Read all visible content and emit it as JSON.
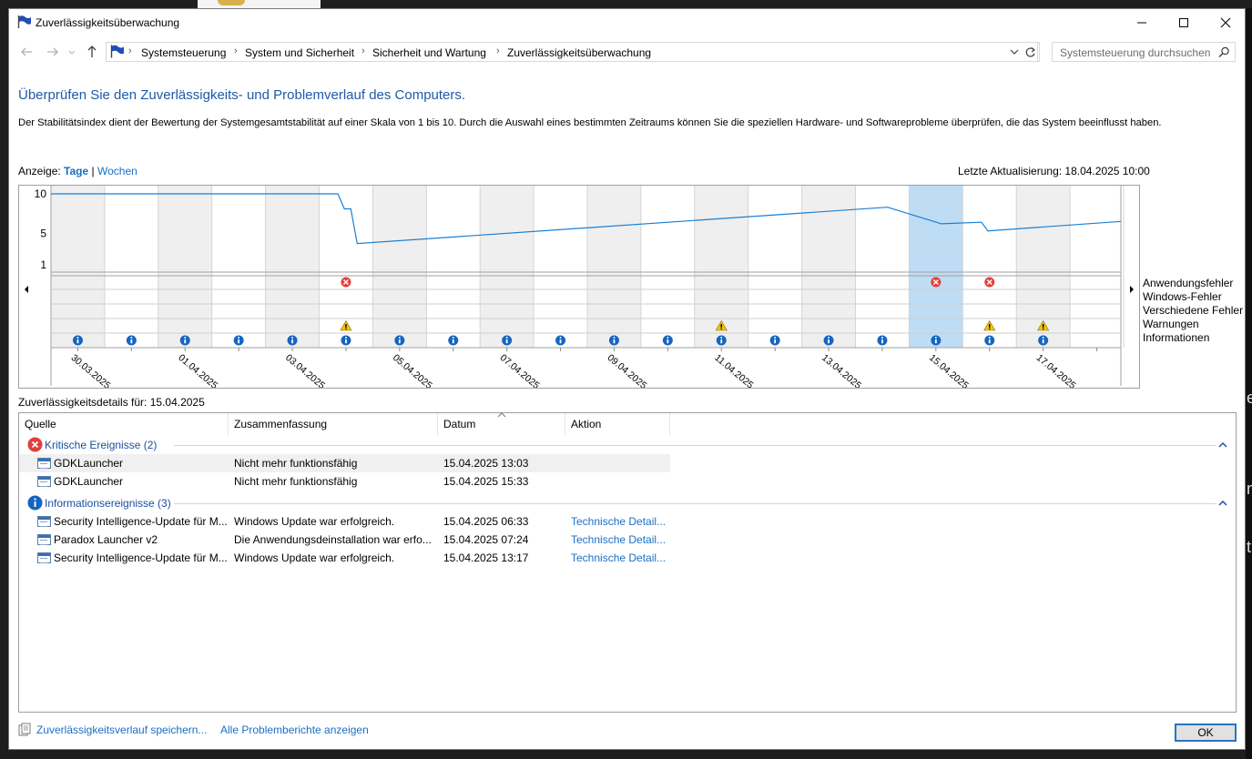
{
  "window": {
    "title": "Zuverlässigkeitsüberwachung"
  },
  "nav": {
    "breadcrumbs": [
      "Systemsteuerung",
      "System und Sicherheit",
      "Sicherheit und Wartung",
      "Zuverlässigkeitsüberwachung"
    ],
    "search_placeholder": "Systemsteuerung durchsuchen"
  },
  "page": {
    "heading": "Überprüfen Sie den Zuverlässigkeits- und Problemverlauf des Computers.",
    "description": "Der Stabilitätsindex dient der Bewertung der Systemgesamtstabilität auf einer Skala von 1 bis 10. Durch die Auswahl eines bestimmten Zeitraums können Sie die speziellen Hardware- und Softwareprobleme überprüfen, die das System beeinflusst haben.",
    "view_label": "Anzeige:",
    "view_days": "Tage",
    "view_separator": "|",
    "view_weeks": "Wochen",
    "last_update": "Letzte Aktualisierung: 18.04.2025 10:00"
  },
  "chart_data": {
    "type": "line",
    "ylim": [
      1,
      10
    ],
    "y_ticks": [
      "10",
      "5",
      "1"
    ],
    "dates": [
      "30.03.2025",
      "31.03.2025",
      "01.04.2025",
      "02.04.2025",
      "03.04.2025",
      "04.04.2025",
      "05.04.2025",
      "06.04.2025",
      "07.04.2025",
      "08.04.2025",
      "09.04.2025",
      "10.04.2025",
      "11.04.2025",
      "12.04.2025",
      "13.04.2025",
      "14.04.2025",
      "15.04.2025",
      "16.04.2025",
      "17.04.2025",
      "18.04.2025"
    ],
    "date_labels": [
      "30.03.2025",
      "01.04.2025",
      "03.04.2025",
      "05.04.2025",
      "07.04.2025",
      "09.04.2025",
      "11.04.2025",
      "13.04.2025",
      "15.04.2025",
      "17.04.2025"
    ],
    "selected_date": "15.04.2025",
    "stability_index": [
      {
        "date": "30.03.2025",
        "value": 10.0
      },
      {
        "date": "03.04.2025",
        "value": 10.0
      },
      {
        "date": "04.04.2025",
        "value": 10.0
      },
      {
        "date": "04.04.2025",
        "value": 8.1
      },
      {
        "date": "04.04.2025",
        "value": 8.1
      },
      {
        "date": "04.04.2025",
        "value": 3.7
      },
      {
        "date": "14.04.2025",
        "value": 8.3
      },
      {
        "date": "15.04.2025",
        "value": 6.2
      },
      {
        "date": "16.04.2025",
        "value": 6.4
      },
      {
        "date": "16.04.2025",
        "value": 5.3
      },
      {
        "date": "18.04.2025",
        "value": 6.5
      }
    ],
    "event_rows": [
      "Anwendungsfehler",
      "Windows-Fehler",
      "Verschiedene Fehler",
      "Warnungen",
      "Informationen"
    ],
    "events": {
      "Anwendungsfehler": [
        "04.04.2025",
        "15.04.2025",
        "16.04.2025"
      ],
      "Windows-Fehler": [],
      "Verschiedene Fehler": [],
      "Warnungen": [
        "04.04.2025",
        "11.04.2025",
        "16.04.2025",
        "17.04.2025"
      ],
      "Informationen": [
        "30.03.2025",
        "31.03.2025",
        "01.04.2025",
        "02.04.2025",
        "03.04.2025",
        "04.04.2025",
        "05.04.2025",
        "06.04.2025",
        "07.04.2025",
        "08.04.2025",
        "09.04.2025",
        "10.04.2025",
        "11.04.2025",
        "12.04.2025",
        "13.04.2025",
        "14.04.2025",
        "15.04.2025",
        "16.04.2025",
        "17.04.2025"
      ]
    },
    "colors": {
      "line": "#1a7fd4",
      "selection": "#bfdcf5",
      "shade": "#efefef",
      "error": "#e0403a",
      "warning": "#f5c400",
      "info": "#1565c0"
    }
  },
  "details": {
    "label": "Zuverlässigkeitsdetails für: 15.04.2025",
    "columns": [
      "Quelle",
      "Zusammenfassung",
      "Datum",
      "Aktion"
    ],
    "groups": [
      {
        "label": "Kritische Ereignisse (2)",
        "icon": "error-icon",
        "rows": [
          {
            "source": "GDKLauncher",
            "summary": "Nicht mehr funktionsfähig",
            "date": "15.04.2025 13:03",
            "action": ""
          },
          {
            "source": "GDKLauncher",
            "summary": "Nicht mehr funktionsfähig",
            "date": "15.04.2025 15:33",
            "action": ""
          }
        ]
      },
      {
        "label": "Informationsereignisse (3)",
        "icon": "info-icon",
        "rows": [
          {
            "source": "Security Intelligence-Update für M...",
            "summary": "Windows Update war erfolgreich.",
            "date": "15.04.2025 06:33",
            "action": "Technische Detail..."
          },
          {
            "source": "Paradox Launcher v2",
            "summary": "Die Anwendungsdeinstallation war erfo...",
            "date": "15.04.2025 07:24",
            "action": "Technische Detail..."
          },
          {
            "source": "Security Intelligence-Update für M...",
            "summary": "Windows Update war erfolgreich.",
            "date": "15.04.2025 13:17",
            "action": "Technische Detail..."
          }
        ]
      }
    ]
  },
  "footer": {
    "save_link": "Zuverlässigkeitsverlauf speichern...",
    "all_reports_link": "Alle Problemberichte anzeigen",
    "ok_label": "OK"
  },
  "background": {
    "right_edge_chars": [
      "e",
      "n",
      "t"
    ]
  }
}
